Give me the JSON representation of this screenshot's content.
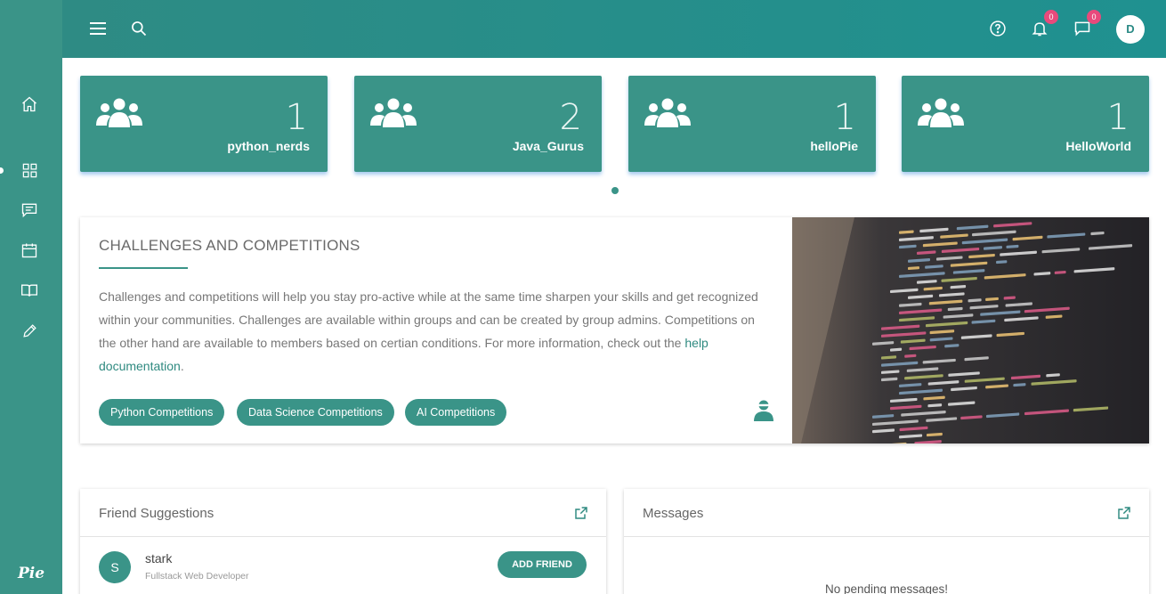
{
  "sidebar": {
    "items": [
      {
        "icon": "home-icon"
      },
      {
        "icon": "dashboard-grid-icon"
      },
      {
        "icon": "chat-icon"
      },
      {
        "icon": "calendar-icon"
      },
      {
        "icon": "book-icon"
      },
      {
        "icon": "pencil-icon"
      }
    ],
    "logo": "Pie"
  },
  "topbar": {
    "notifications_count": "0",
    "messages_count": "0",
    "avatar_initial": "D"
  },
  "groups": [
    {
      "count": "1",
      "name": "python_nerds"
    },
    {
      "count": "2",
      "name": "Java_Gurus"
    },
    {
      "count": "1",
      "name": "helloPie"
    },
    {
      "count": "1",
      "name": "HelloWorld"
    }
  ],
  "challenges": {
    "title": "CHALLENGES AND COMPETITIONS",
    "body": "Challenges and competitions will help you stay pro-active while at the same time sharpen your skills and get recognized within your communities. Challenges are available within groups and can be created by group admins. Competitions on the other hand are available to members based on certian conditions. For more information, check out the ",
    "link_text": "help documentation",
    "body_end": ".",
    "buttons": [
      "Python Competitions",
      "Data Science Competitions",
      "AI Competitions"
    ]
  },
  "friend_suggestions": {
    "title": "Friend Suggestions",
    "items": [
      {
        "initial": "S",
        "name": "stark",
        "role": "Fullstack Web Developer",
        "action": "ADD FRIEND"
      }
    ]
  },
  "messages": {
    "title": "Messages",
    "empty_text": "No pending messages!"
  },
  "colors": {
    "primary": "#3a9488",
    "topbar": "#2e8b84",
    "badge": "#e84a7c"
  }
}
